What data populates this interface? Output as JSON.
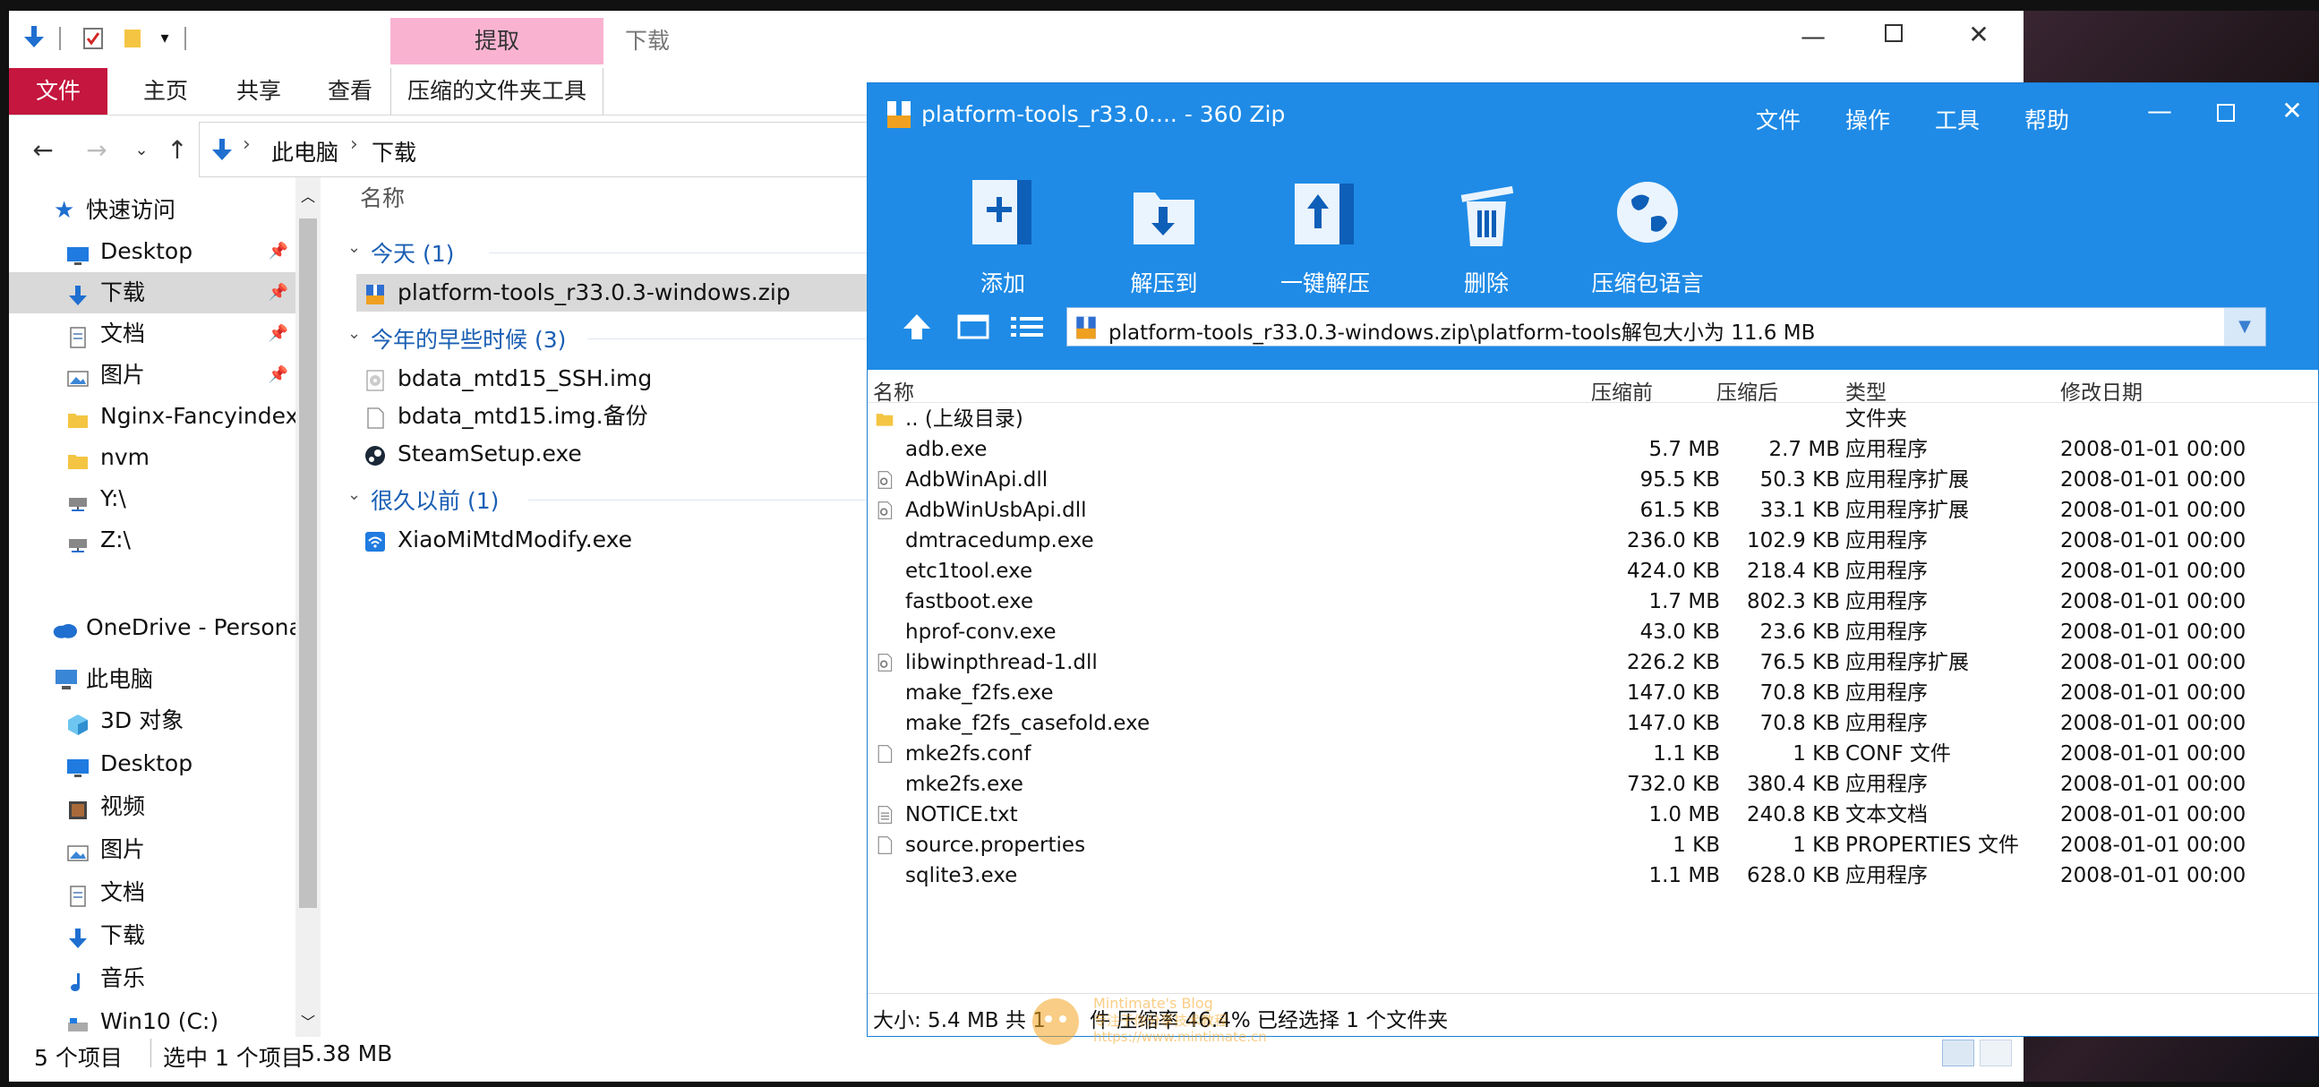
{
  "explorer": {
    "quick_access_toolbar": {
      "dropdown_glyph": "▾"
    },
    "ribbon": {
      "tabs": [
        "文件",
        "主页",
        "共享",
        "查看"
      ],
      "context_group_label": "提取",
      "context_tab": "压缩的文件夹工具",
      "window_title": "下载"
    },
    "breadcrumb": [
      "此电脑",
      "下载"
    ],
    "column_header": "名称",
    "sidebar": {
      "quick_access": "快速访问",
      "items": [
        {
          "label": "Desktop",
          "icon": "desktop-folder-icon",
          "pinned": true
        },
        {
          "label": "下载",
          "icon": "download-folder-icon",
          "pinned": true,
          "selected": true
        },
        {
          "label": "文档",
          "icon": "documents-folder-icon",
          "pinned": true
        },
        {
          "label": "图片",
          "icon": "pictures-folder-icon",
          "pinned": true
        },
        {
          "label": "Nginx-Fancyindex-",
          "icon": "folder-icon"
        },
        {
          "label": "nvm",
          "icon": "folder-icon"
        },
        {
          "label": "Y:\\",
          "icon": "network-drive-icon"
        },
        {
          "label": "Z:\\",
          "icon": "network-drive-icon"
        }
      ],
      "onedrive": "OneDrive - Personal",
      "this_pc": "此电脑",
      "pc_items": [
        {
          "label": "3D 对象",
          "icon": "3d-objects-icon"
        },
        {
          "label": "Desktop",
          "icon": "desktop-folder-icon"
        },
        {
          "label": "视频",
          "icon": "videos-folder-icon"
        },
        {
          "label": "图片",
          "icon": "pictures-folder-icon"
        },
        {
          "label": "文档",
          "icon": "documents-folder-icon"
        },
        {
          "label": "下载",
          "icon": "download-folder-icon"
        },
        {
          "label": "音乐",
          "icon": "music-folder-icon"
        },
        {
          "label": "Win10 (C:)",
          "icon": "drive-icon"
        }
      ]
    },
    "groups": [
      {
        "title": "今天 (1)",
        "files": [
          {
            "name": "platform-tools_r33.0.3-windows.zip",
            "icon": "zip-archive-icon",
            "selected": true
          }
        ]
      },
      {
        "title": "今年的早些时候 (3)",
        "files": [
          {
            "name": "bdata_mtd15_SSH.img",
            "icon": "disc-image-icon"
          },
          {
            "name": "bdata_mtd15.img.备份",
            "icon": "blank-file-icon"
          },
          {
            "name": "SteamSetup.exe",
            "icon": "steam-icon"
          }
        ]
      },
      {
        "title": "很久以前 (1)",
        "files": [
          {
            "name": "XiaoMiMtdModify.exe",
            "icon": "wifi-app-icon"
          }
        ]
      }
    ],
    "status": {
      "count": "5 个项目",
      "selected": "选中 1 个项目",
      "size": "5.38 MB"
    }
  },
  "zip": {
    "title": "platform-tools_r33.0.... - 360 Zip",
    "menu": [
      "文件",
      "操作",
      "工具",
      "帮助"
    ],
    "toolbar": [
      {
        "label": "添加",
        "icon": "add-archive-icon"
      },
      {
        "label": "解压到",
        "icon": "extract-to-icon"
      },
      {
        "label": "一键解压",
        "icon": "one-click-extract-icon"
      },
      {
        "label": "删除",
        "icon": "delete-trash-icon"
      },
      {
        "label": "压缩包语言",
        "icon": "globe-language-icon"
      }
    ],
    "path": "platform-tools_r33.0.3-windows.zip\\platform-tools解包大小为 11.6 MB",
    "columns": {
      "name": "名称",
      "before": "压缩前",
      "after": "压缩后",
      "type": "类型",
      "date": "修改日期"
    },
    "rows": [
      {
        "name": ".. (上级目录)",
        "before": "",
        "after": "",
        "type": "文件夹",
        "date": "",
        "icon": "folder-icon"
      },
      {
        "name": "adb.exe",
        "before": "5.7 MB",
        "after": "2.7 MB",
        "type": "应用程序",
        "date": "2008-01-01 00:00",
        "icon": "none"
      },
      {
        "name": "AdbWinApi.dll",
        "before": "95.5 KB",
        "after": "50.3 KB",
        "type": "应用程序扩展",
        "date": "2008-01-01 00:00",
        "icon": "dll-file-icon"
      },
      {
        "name": "AdbWinUsbApi.dll",
        "before": "61.5 KB",
        "after": "33.1 KB",
        "type": "应用程序扩展",
        "date": "2008-01-01 00:00",
        "icon": "dll-file-icon"
      },
      {
        "name": "dmtracedump.exe",
        "before": "236.0 KB",
        "after": "102.9 KB",
        "type": "应用程序",
        "date": "2008-01-01 00:00",
        "icon": "none"
      },
      {
        "name": "etc1tool.exe",
        "before": "424.0 KB",
        "after": "218.4 KB",
        "type": "应用程序",
        "date": "2008-01-01 00:00",
        "icon": "none"
      },
      {
        "name": "fastboot.exe",
        "before": "1.7 MB",
        "after": "802.3 KB",
        "type": "应用程序",
        "date": "2008-01-01 00:00",
        "icon": "none"
      },
      {
        "name": "hprof-conv.exe",
        "before": "43.0 KB",
        "after": "23.6 KB",
        "type": "应用程序",
        "date": "2008-01-01 00:00",
        "icon": "none"
      },
      {
        "name": "libwinpthread-1.dll",
        "before": "226.2 KB",
        "after": "76.5 KB",
        "type": "应用程序扩展",
        "date": "2008-01-01 00:00",
        "icon": "dll-file-icon"
      },
      {
        "name": "make_f2fs.exe",
        "before": "147.0 KB",
        "after": "70.8 KB",
        "type": "应用程序",
        "date": "2008-01-01 00:00",
        "icon": "none"
      },
      {
        "name": "make_f2fs_casefold.exe",
        "before": "147.0 KB",
        "after": "70.8 KB",
        "type": "应用程序",
        "date": "2008-01-01 00:00",
        "icon": "none"
      },
      {
        "name": "mke2fs.conf",
        "before": "1.1 KB",
        "after": "1 KB",
        "type": "CONF 文件",
        "date": "2008-01-01 00:00",
        "icon": "blank-file-icon"
      },
      {
        "name": "mke2fs.exe",
        "before": "732.0 KB",
        "after": "380.4 KB",
        "type": "应用程序",
        "date": "2008-01-01 00:00",
        "icon": "none"
      },
      {
        "name": "NOTICE.txt",
        "before": "1.0 MB",
        "after": "240.8 KB",
        "type": "文本文档",
        "date": "2008-01-01 00:00",
        "icon": "text-file-icon"
      },
      {
        "name": "source.properties",
        "before": "1 KB",
        "after": "1 KB",
        "type": "PROPERTIES 文件",
        "date": "2008-01-01 00:00",
        "icon": "blank-file-icon"
      },
      {
        "name": "sqlite3.exe",
        "before": "1.1 MB",
        "after": "628.0 KB",
        "type": "应用程序",
        "date": "2008-01-01 00:00",
        "icon": "none"
      }
    ],
    "status_left": "大小: 5.4 MB 共 1",
    "status_right": "件 压缩率 46.4% 已经选择 1 个文件夹"
  },
  "watermark": {
    "site": "https://www.mintimate.cn",
    "caption": "专注于你分享技术教程",
    "brand": "Mintimate's Blog"
  },
  "colors": {
    "ribbon_file_tab": "#c4163e",
    "context_tab_pink": "#f9b3d1",
    "zip_blue": "#1f8be6",
    "selection": "#d9d9d9",
    "link_blue": "#1a5fb4"
  }
}
